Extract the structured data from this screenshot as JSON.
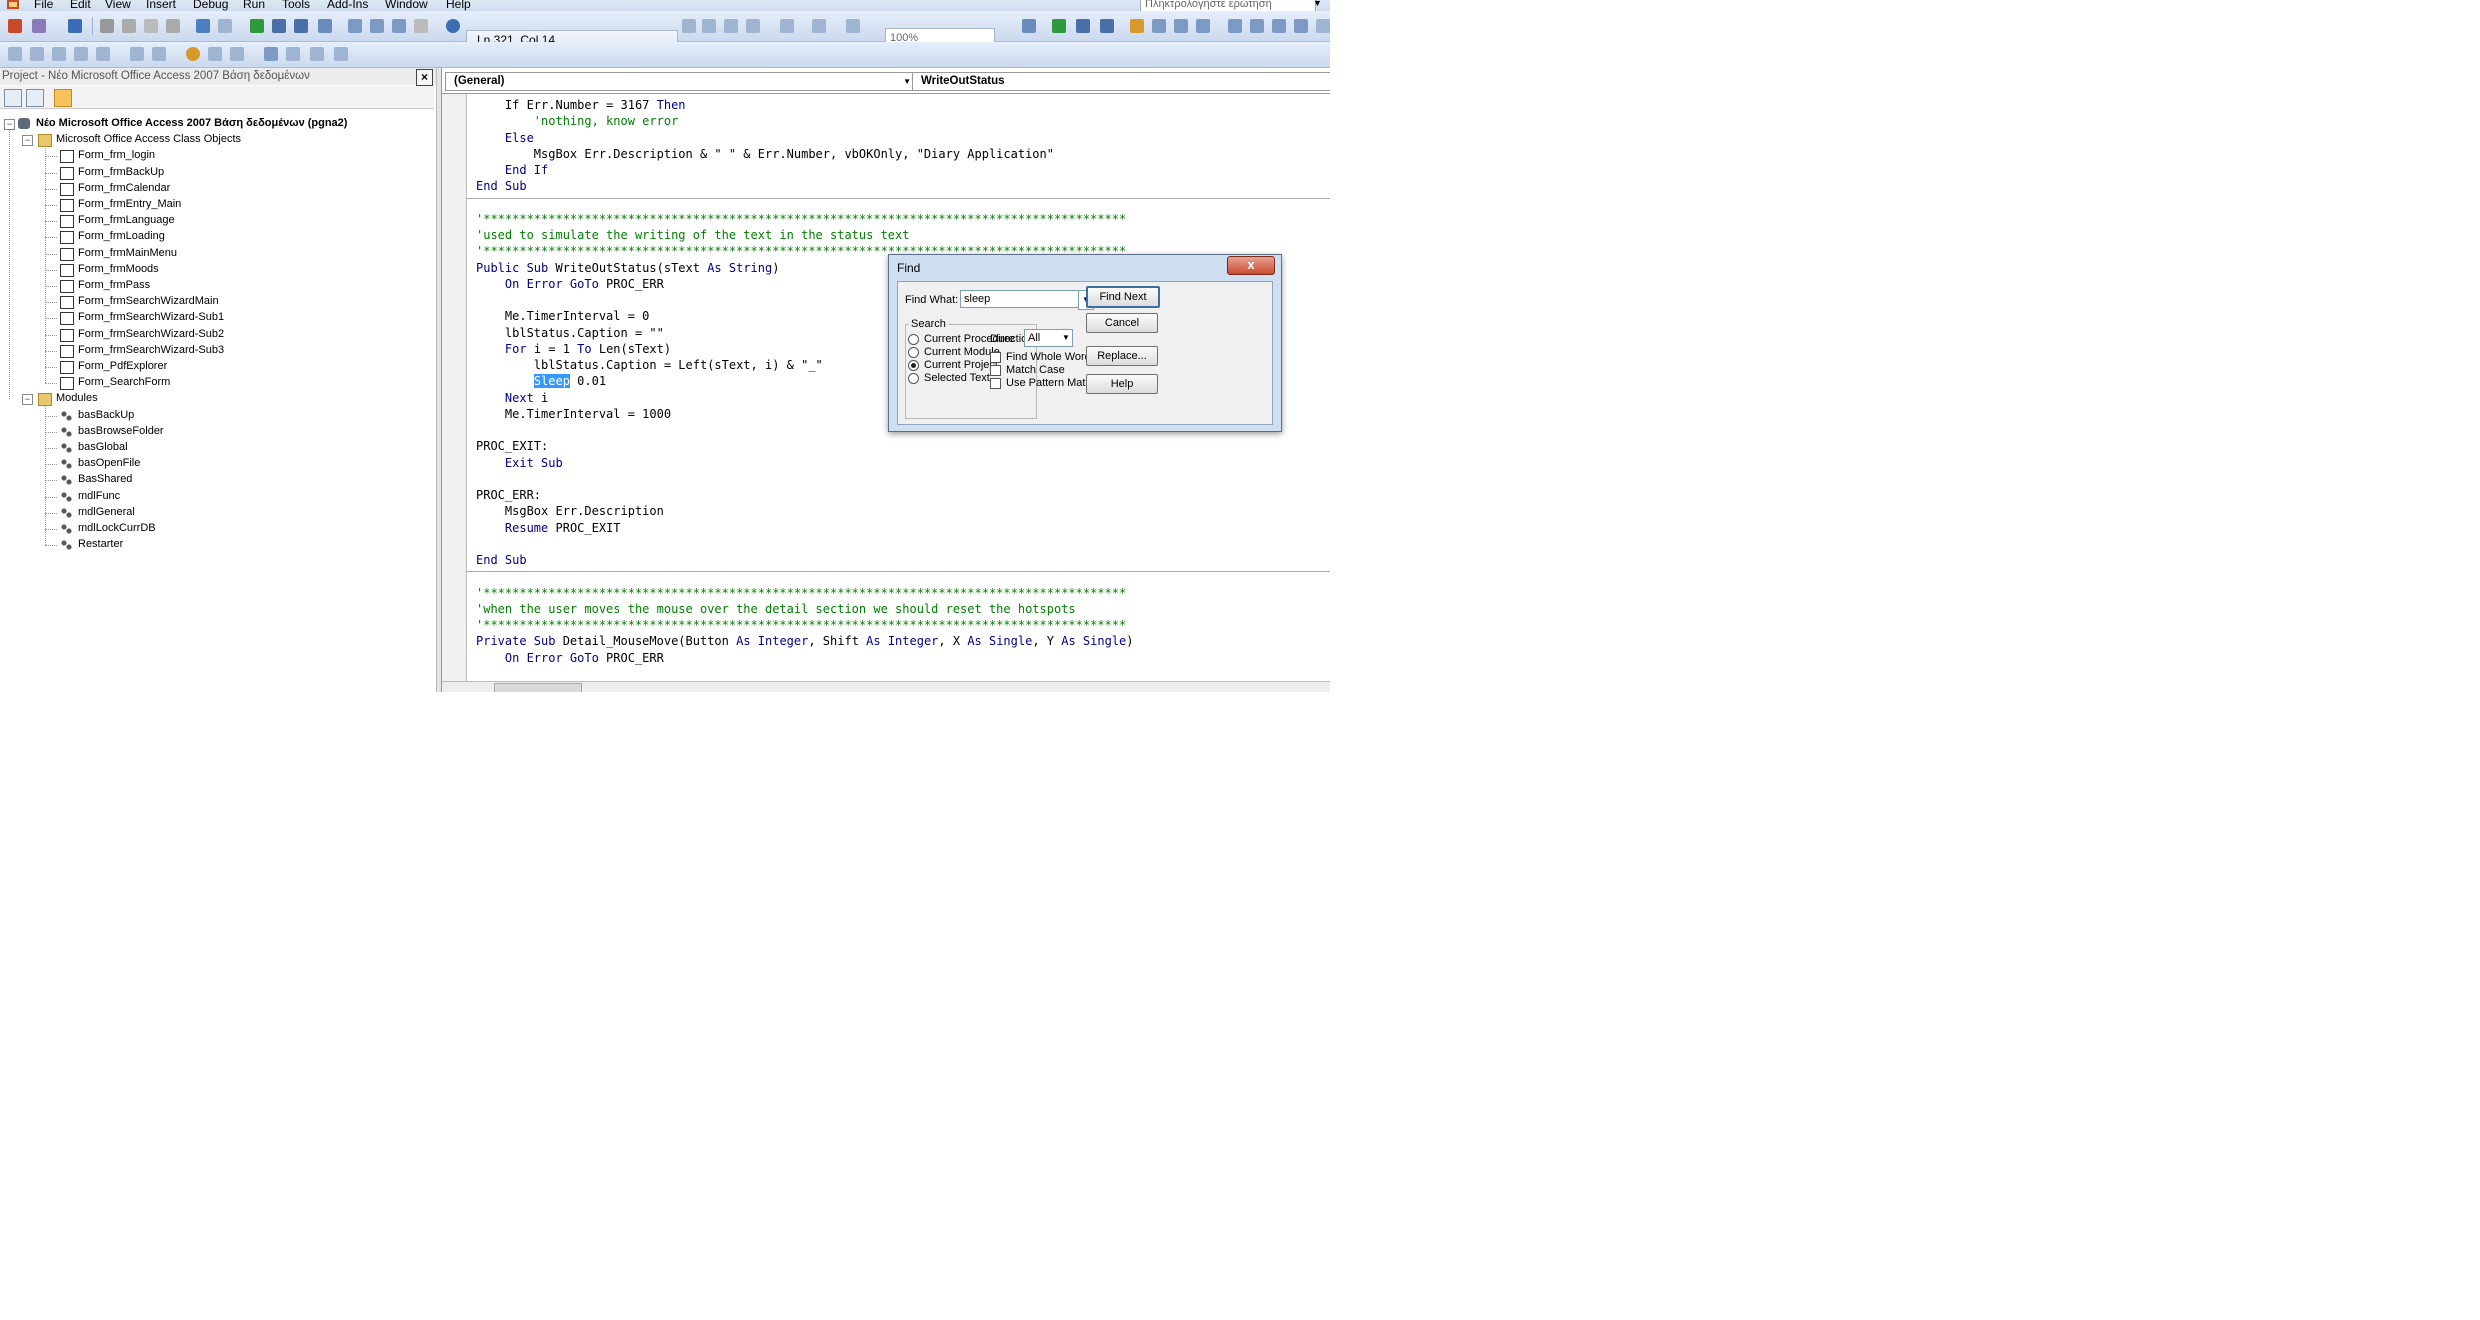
{
  "menu": [
    "File",
    "Edit",
    "View",
    "Insert",
    "Debug",
    "Run",
    "Tools",
    "Add-Ins",
    "Window",
    "Help"
  ],
  "ask_placeholder": "Πληκτρολογήστε ερώτηση",
  "toolbar": {
    "position": "Ln 321, Col 14",
    "zoom": "100%"
  },
  "project": {
    "title": "Project - Νέο Microsoft Office Access 2007 Βάση δεδομένων",
    "root": "Νέο Microsoft Office Access 2007 Βάση δεδομένων (pgna2)",
    "folders": [
      {
        "name": "Microsoft Office Access Class Objects",
        "items": [
          "Form_frm_login",
          "Form_frmBackUp",
          "Form_frmCalendar",
          "Form_frmEntry_Main",
          "Form_frmLanguage",
          "Form_frmLoading",
          "Form_frmMainMenu",
          "Form_frmMoods",
          "Form_frmPass",
          "Form_frmSearchWizardMain",
          "Form_frmSearchWizard-Sub1",
          "Form_frmSearchWizard-Sub2",
          "Form_frmSearchWizard-Sub3",
          "Form_PdfExplorer",
          "Form_SearchForm"
        ]
      },
      {
        "name": "Modules",
        "items": [
          "basBackUp",
          "basBrowseFolder",
          "basGlobal",
          "basOpenFile",
          "BasShared",
          "mdlFunc",
          "mdlGeneral",
          "mdlLockCurrDB",
          "Restarter"
        ]
      }
    ]
  },
  "code": {
    "object_combo": "(General)",
    "proc_combo": "WriteOutStatus",
    "lines": [
      {
        "segs": [
          [
            "    If Err.Number = 3167 ",
            "n"
          ],
          [
            "Then",
            "k"
          ]
        ]
      },
      {
        "segs": [
          [
            "        'nothing, know error",
            "c"
          ]
        ]
      },
      {
        "segs": [
          [
            "    ",
            "n"
          ],
          [
            "Else",
            "k"
          ]
        ]
      },
      {
        "segs": [
          [
            "        MsgBox Err.Description & \" \" & Err.Number, vbOKOnly, \"Diary Application\"",
            "n"
          ]
        ]
      },
      {
        "segs": [
          [
            "    ",
            "n"
          ],
          [
            "End If",
            "k"
          ]
        ]
      },
      {
        "segs": [
          [
            "End Sub",
            "k"
          ]
        ]
      },
      {
        "sep": true
      },
      {
        "segs": [
          [
            "'*****************************************************************************************",
            "c"
          ]
        ]
      },
      {
        "segs": [
          [
            "'used to simulate the writing of the text in the status text",
            "c"
          ]
        ]
      },
      {
        "segs": [
          [
            "'*****************************************************************************************",
            "c"
          ]
        ]
      },
      {
        "segs": [
          [
            "Public Sub",
            "k"
          ],
          [
            " WriteOutStatus(sText ",
            "n"
          ],
          [
            "As String",
            "k"
          ],
          [
            ")",
            "n"
          ]
        ]
      },
      {
        "segs": [
          [
            "    ",
            "n"
          ],
          [
            "On Error GoTo",
            "k"
          ],
          [
            " PROC_ERR",
            "n"
          ]
        ]
      },
      {
        "segs": [
          [
            "",
            "n"
          ]
        ]
      },
      {
        "segs": [
          [
            "    Me.TimerInterval = 0",
            "n"
          ]
        ]
      },
      {
        "segs": [
          [
            "    lblStatus.Caption = \"\"",
            "n"
          ]
        ]
      },
      {
        "segs": [
          [
            "    ",
            "n"
          ],
          [
            "For",
            "k"
          ],
          [
            " i = 1 ",
            "n"
          ],
          [
            "To",
            "k"
          ],
          [
            " Len(sText)",
            "n"
          ]
        ]
      },
      {
        "segs": [
          [
            "        lblStatus.Caption = Left(sText, i) & \"_\"",
            "n"
          ]
        ]
      },
      {
        "segs": [
          [
            "        ",
            "n"
          ],
          [
            "Sleep",
            "h"
          ],
          [
            " 0.01",
            "n"
          ]
        ]
      },
      {
        "segs": [
          [
            "    ",
            "n"
          ],
          [
            "Next",
            "k"
          ],
          [
            " i",
            "n"
          ]
        ]
      },
      {
        "segs": [
          [
            "    Me.TimerInterval = 1000",
            "n"
          ]
        ]
      },
      {
        "segs": [
          [
            "",
            "n"
          ]
        ]
      },
      {
        "segs": [
          [
            "PROC_EXIT:",
            "n"
          ]
        ]
      },
      {
        "segs": [
          [
            "    ",
            "n"
          ],
          [
            "Exit Sub",
            "k"
          ]
        ]
      },
      {
        "segs": [
          [
            "",
            "n"
          ]
        ]
      },
      {
        "segs": [
          [
            "PROC_ERR:",
            "n"
          ]
        ]
      },
      {
        "segs": [
          [
            "    MsgBox Err.Description",
            "n"
          ]
        ]
      },
      {
        "segs": [
          [
            "    ",
            "n"
          ],
          [
            "Resume",
            "k"
          ],
          [
            " PROC_EXIT",
            "n"
          ]
        ]
      },
      {
        "segs": [
          [
            "",
            "n"
          ]
        ]
      },
      {
        "segs": [
          [
            "End Sub",
            "k"
          ]
        ]
      },
      {
        "sep": true
      },
      {
        "segs": [
          [
            "'*****************************************************************************************",
            "c"
          ]
        ]
      },
      {
        "segs": [
          [
            "'when the user moves the mouse over the detail section we should reset the hotspots",
            "c"
          ]
        ]
      },
      {
        "segs": [
          [
            "'*****************************************************************************************",
            "c"
          ]
        ]
      },
      {
        "segs": [
          [
            "Private Sub",
            "k"
          ],
          [
            " Detail_MouseMove(Button ",
            "n"
          ],
          [
            "As Integer",
            "k"
          ],
          [
            ", Shift ",
            "n"
          ],
          [
            "As Integer",
            "k"
          ],
          [
            ", X ",
            "n"
          ],
          [
            "As Single",
            "k"
          ],
          [
            ", Y ",
            "n"
          ],
          [
            "As Single",
            "k"
          ],
          [
            ")",
            "n"
          ]
        ]
      },
      {
        "segs": [
          [
            "    ",
            "n"
          ],
          [
            "On Error GoTo",
            "k"
          ],
          [
            " PROC_ERR",
            "n"
          ]
        ]
      }
    ]
  },
  "find": {
    "title": "Find",
    "find_what_label": "Find What:",
    "find_what_value": "sleep",
    "search_label": "Search",
    "scopes": [
      {
        "label": "Current Procedure",
        "selected": false
      },
      {
        "label": "Current Module",
        "selected": false
      },
      {
        "label": "Current Project",
        "selected": true
      },
      {
        "label": "Selected Text",
        "selected": false
      }
    ],
    "direction_label": "Direction:",
    "direction_value": "All",
    "options": [
      {
        "label": "Find Whole Word Only",
        "checked": false
      },
      {
        "label": "Match Case",
        "checked": false
      },
      {
        "label": "Use Pattern Matching",
        "checked": false
      }
    ],
    "buttons": [
      "Find Next",
      "Cancel",
      "Replace...",
      "Help"
    ],
    "close_glyph": "x"
  }
}
